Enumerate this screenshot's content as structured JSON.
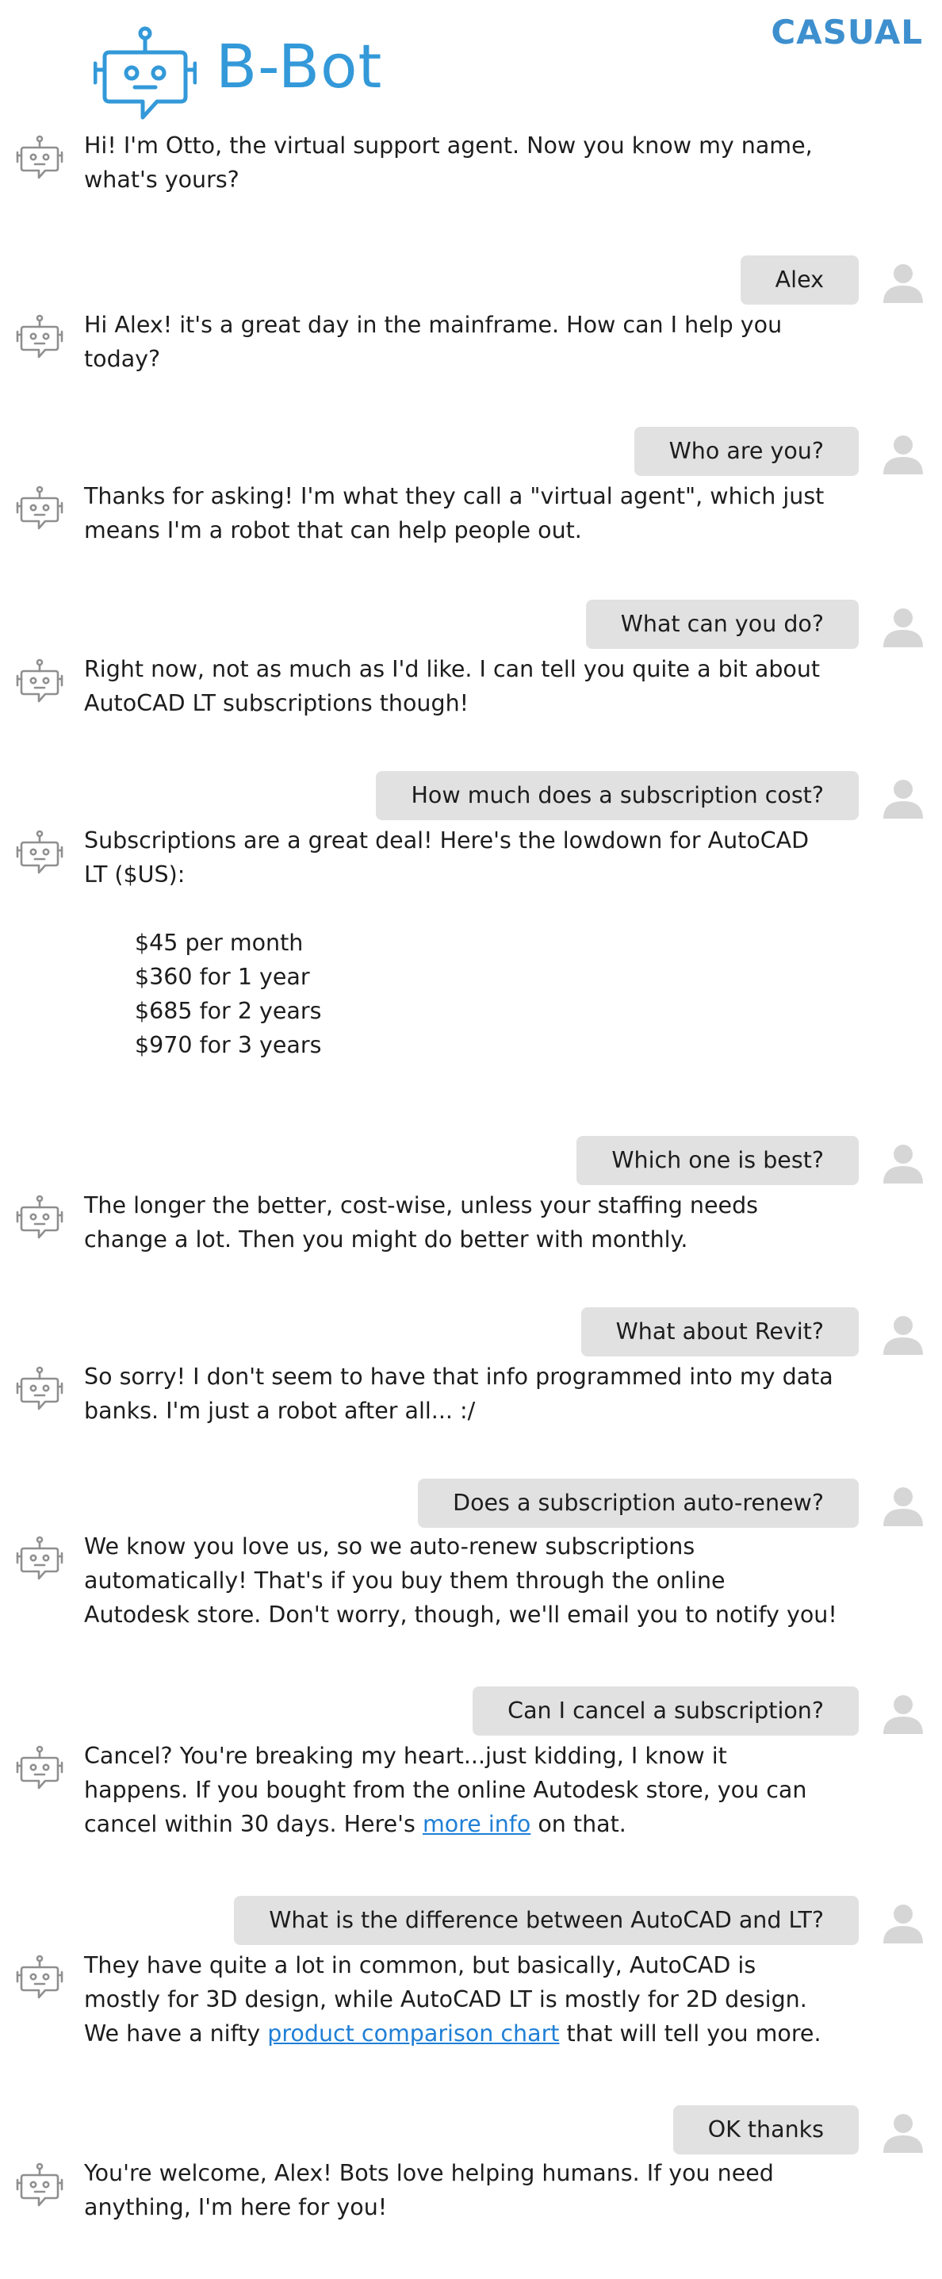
{
  "header": {
    "brand": "B-Bot",
    "mode": "CASUAL",
    "logo_icon": "robot-chat-icon",
    "accent_color": "#3399d9"
  },
  "chat": {
    "bot_icon": "robot-icon",
    "user_icon": "user-silhouette-icon",
    "bubble_color": "#e1e1e1",
    "link_color": "#1f7fd6",
    "messages": [
      {
        "from": "bot",
        "text": "Hi! I'm Otto, the virtual support agent. Now you know my name,\nwhat's yours?"
      },
      {
        "from": "user",
        "text": "Alex"
      },
      {
        "from": "bot",
        "text": "Hi Alex! it's a great day in the mainframe. How can I help you\ntoday?"
      },
      {
        "from": "user",
        "text": "Who are you?"
      },
      {
        "from": "bot",
        "text": "Thanks for asking! I'm what they call a \"virtual agent\", which just\nmeans I'm a robot that can help people out."
      },
      {
        "from": "user",
        "text": "What can you do?"
      },
      {
        "from": "bot",
        "text": "Right now, not as much as I'd like. I can tell you quite a bit about\nAutoCAD LT subscriptions though!"
      },
      {
        "from": "user",
        "text": "How much does a subscription cost?"
      },
      {
        "from": "bot",
        "text": "Subscriptions are a great deal! Here's the lowdown for AutoCAD\nLT ($US):",
        "prices": [
          "$45 per month",
          "$360 for 1 year",
          "$685 for 2 years",
          "$970 for 3 years"
        ]
      },
      {
        "from": "user",
        "text": "Which one is best?"
      },
      {
        "from": "bot",
        "text": "The longer the better, cost-wise, unless your staffing needs\nchange a lot. Then you might do better with monthly."
      },
      {
        "from": "user",
        "text": "What about Revit?"
      },
      {
        "from": "bot",
        "text": "So sorry! I don't seem to have that info programmed into my data\nbanks. I'm just a robot after all...  :/"
      },
      {
        "from": "user",
        "text": "Does a subscription auto-renew?"
      },
      {
        "from": "bot",
        "text": "We know you love us, so we auto-renew subscriptions\nautomatically! That's if you buy them through the online\nAutodesk store. Don't worry, though, we'll email you to notify you!"
      },
      {
        "from": "user",
        "text": "Can I cancel a subscription?"
      },
      {
        "from": "bot",
        "text_before": "Cancel? You're breaking my heart...just kidding, I know it\nhappens. If you bought from the online Autodesk store, you can\ncancel within 30 days. Here's ",
        "link": "more info",
        "text_after": " on that."
      },
      {
        "from": "user",
        "text": "What is the difference between AutoCAD and LT?"
      },
      {
        "from": "bot",
        "text_before": "They have quite a lot in common, but basically, AutoCAD is\nmostly for 3D design, while AutoCAD LT is mostly for 2D design.\nWe have a nifty ",
        "link": "product comparison chart",
        "text_after": " that will tell you more."
      },
      {
        "from": "user",
        "text": "OK thanks"
      },
      {
        "from": "bot",
        "text": "You're welcome, Alex! Bots love helping humans. If you need\nanything, I'm here for you!"
      }
    ]
  }
}
